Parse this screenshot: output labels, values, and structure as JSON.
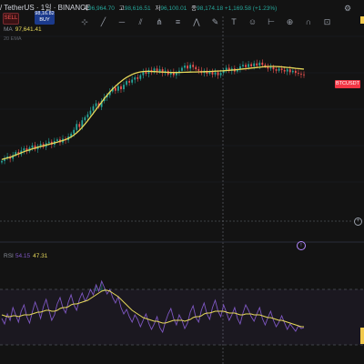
{
  "header": {
    "symbol_title": "/ TetherUS · 1일 · BINANCE",
    "ohlc": [
      {
        "label": "시",
        "value": "96,964.70"
      },
      {
        "label": "고",
        "value": "98,616.51"
      },
      {
        "label": "저",
        "value": "96,100.01"
      },
      {
        "label": "종",
        "value": "98,174.18"
      }
    ],
    "change": "+1,169.58 (+1.23%)"
  },
  "drawing_tools": [
    {
      "icon": "crosshair-icon",
      "glyph": "⊹"
    },
    {
      "icon": "trend-line-icon",
      "glyph": "╱"
    },
    {
      "icon": "horizontal-line-icon",
      "glyph": "─"
    },
    {
      "icon": "channel-icon",
      "glyph": "⫽"
    },
    {
      "icon": "pitchfork-icon",
      "glyph": "⋔"
    },
    {
      "icon": "fib-icon",
      "glyph": "≡"
    },
    {
      "icon": "pattern-icon",
      "glyph": "⋀"
    },
    {
      "icon": "brush-icon",
      "glyph": "✎"
    },
    {
      "icon": "text-icon",
      "glyph": "T"
    },
    {
      "icon": "emoji-icon",
      "glyph": "☺"
    },
    {
      "icon": "measure-icon",
      "glyph": "⊢"
    },
    {
      "icon": "zoom-icon",
      "glyph": "⊕"
    },
    {
      "icon": "magnet-icon",
      "glyph": "∩"
    },
    {
      "icon": "lock-icon",
      "glyph": "⊡"
    }
  ],
  "trade": {
    "sell_label": "SELL",
    "buy_price": "98,16.82",
    "buy_label": "BUY"
  },
  "indicators": {
    "ma_name": "MA",
    "ma_value": "97,641.41",
    "second_line": "20 EMA",
    "price_tag": "BTCUSDT",
    "rsi_name": "RSI",
    "rsi_value": "54.15",
    "rsi_ma_value": "47.31"
  },
  "colors": {
    "background": "#131313",
    "up": "#26a69a",
    "down": "#ef5350",
    "ma": "#e6d85a",
    "rsi": "#7e57c2"
  },
  "chart_data": [
    {
      "type": "line",
      "title": "",
      "xlabel": "",
      "ylabel": "",
      "x": [
        0,
        1,
        2,
        3,
        4,
        5,
        6,
        7,
        8,
        9,
        10,
        11,
        12,
        13,
        14,
        15,
        16,
        17,
        18,
        19,
        20,
        21,
        22,
        23,
        24,
        25,
        26,
        27,
        28,
        29,
        30,
        31,
        32,
        33,
        34,
        35,
        36,
        37,
        38,
        39,
        40,
        41,
        42,
        43,
        44,
        45,
        46,
        47,
        48,
        49,
        50,
        51,
        52,
        53,
        54,
        55,
        56,
        57,
        58,
        59,
        60,
        61,
        62,
        63,
        64,
        65,
        66,
        67,
        68,
        69,
        70,
        71,
        72,
        73,
        74,
        75,
        76,
        77,
        78,
        79,
        80,
        81,
        82,
        83,
        84,
        85,
        86,
        87,
        88,
        89,
        90,
        91,
        92,
        93,
        94,
        95,
        96,
        97,
        98,
        99,
        100,
        101,
        102,
        103,
        104,
        105,
        106,
        107,
        108,
        109
      ],
      "series": [
        {
          "values": [
            91500,
            91900,
            92100,
            91800,
            92300,
            92700,
            92400,
            92900,
            93200,
            92800,
            93300,
            93600,
            93100,
            93500,
            93800,
            93400,
            93900,
            94100,
            93700,
            94200,
            94400,
            94000,
            94500,
            94300,
            94800,
            95200,
            95700,
            96500,
            96100,
            97000,
            97400,
            97800,
            98300,
            98900,
            99300,
            98800,
            99600,
            100100,
            100400,
            100900,
            101400,
            101000,
            101600,
            101200,
            101800,
            102300,
            102100,
            102500,
            102800,
            102600,
            103100,
            103600,
            103300,
            103800,
            103500,
            104000,
            103600,
            103900,
            103400,
            103700,
            103200,
            103500,
            103100,
            103400,
            103700,
            104100,
            104400,
            104000,
            104500,
            104200,
            103900,
            103700,
            103400,
            103700,
            103300,
            103600,
            103200,
            103500,
            103100,
            103400,
            103800,
            104100,
            103700,
            104000,
            103600,
            103900,
            104300,
            104500,
            104200,
            104600,
            104300,
            104700,
            104400,
            104800,
            104500,
            104300,
            104000,
            104200,
            103900,
            103700,
            104000,
            103800,
            103600,
            103900,
            103500,
            103700,
            103400,
            103300,
            103200,
            103100
          ]
        },
        {
          "name": "MA",
          "values": [
            91700,
            91800,
            91900,
            92000,
            92150,
            92300,
            92450,
            92600,
            92750,
            92900,
            93000,
            93150,
            93250,
            93350,
            93450,
            93550,
            93650,
            93750,
            93850,
            93950,
            94050,
            94150,
            94250,
            94400,
            94550,
            94750,
            95000,
            95300,
            95650,
            96050,
            96500,
            96950,
            97450,
            97950,
            98450,
            98950,
            99450,
            99950,
            100400,
            100850,
            101250,
            101600,
            101950,
            102250,
            102550,
            102800,
            103000,
            103200,
            103350,
            103450,
            103550,
            103600,
            103620,
            103620,
            103600,
            103580,
            103560,
            103540,
            103520,
            103500,
            103480,
            103470,
            103460,
            103460,
            103470,
            103480,
            103500,
            103510,
            103520,
            103530,
            103540,
            103550,
            103560,
            103570,
            103580,
            103600,
            103620,
            103640,
            103660,
            103680,
            103700,
            103730,
            103760,
            103790,
            103820,
            103860,
            103900,
            103940,
            103980,
            104020,
            104060,
            104100,
            104140,
            104180,
            104220,
            104250,
            104270,
            104280,
            104280,
            104270,
            104250,
            104220,
            104190,
            104150,
            104110,
            104070,
            104030,
            103990,
            103950,
            103910
          ]
        }
      ]
    },
    {
      "type": "line",
      "title": "",
      "xlabel": "",
      "ylabel": "",
      "x": [
        0,
        1,
        2,
        3,
        4,
        5,
        6,
        7,
        8,
        9,
        10,
        11,
        12,
        13,
        14,
        15,
        16,
        17,
        18,
        19,
        20,
        21,
        22,
        23,
        24,
        25,
        26,
        27,
        28,
        29,
        30,
        31,
        32,
        33,
        34,
        35,
        36,
        37,
        38,
        39,
        40,
        41,
        42,
        43,
        44,
        45,
        46,
        47,
        48,
        49,
        50,
        51,
        52,
        53,
        54,
        55,
        56,
        57,
        58,
        59,
        60,
        61,
        62,
        63,
        64,
        65,
        66,
        67,
        68,
        69,
        70,
        71,
        72,
        73,
        74,
        75,
        76,
        77,
        78,
        79,
        80,
        81,
        82,
        83,
        84,
        85,
        86,
        87,
        88,
        89,
        90,
        91,
        92,
        93,
        94,
        95,
        96,
        97,
        98,
        99,
        100,
        101,
        102,
        103,
        104,
        105,
        106,
        107,
        108,
        109
      ],
      "ylim": [
        0,
        100
      ],
      "series": [
        {
          "name": "RSI",
          "values": [
            40,
            34,
            45,
            38,
            52,
            44,
            36,
            48,
            55,
            42,
            35,
            47,
            58,
            50,
            40,
            53,
            61,
            49,
            38,
            44,
            56,
            63,
            52,
            46,
            58,
            66,
            55,
            49,
            61,
            68,
            59,
            64,
            72,
            66,
            77,
            70,
            81,
            74,
            67,
            72,
            63,
            57,
            64,
            52,
            45,
            50,
            42,
            36,
            44,
            39,
            31,
            38,
            45,
            35,
            28,
            34,
            42,
            30,
            25,
            36,
            45,
            51,
            40,
            33,
            44,
            38,
            29,
            35,
            47,
            54,
            41,
            36,
            49,
            57,
            45,
            39,
            52,
            60,
            48,
            42,
            55,
            47,
            38,
            44,
            52,
            40,
            34,
            46,
            55,
            49,
            42,
            37,
            45,
            52,
            40,
            33,
            41,
            48,
            38,
            31,
            36,
            43,
            35,
            28,
            34,
            30,
            26,
            32,
            29,
            30
          ]
        },
        {
          "name": "RSI MA",
          "values": [
            44,
            43,
            42,
            42,
            43,
            43,
            42,
            43,
            44,
            44,
            44,
            45,
            46,
            47,
            47,
            48,
            49,
            49,
            48,
            48,
            49,
            51,
            52,
            52,
            53,
            55,
            56,
            56,
            57,
            58,
            59,
            60,
            62,
            64,
            66,
            68,
            70,
            71,
            71,
            70,
            68,
            66,
            64,
            61,
            58,
            55,
            52,
            49,
            47,
            45,
            43,
            41,
            40,
            39,
            38,
            37,
            37,
            36,
            35,
            35,
            36,
            37,
            38,
            38,
            38,
            38,
            37,
            38,
            39,
            41,
            42,
            42,
            43,
            45,
            46,
            46,
            47,
            48,
            48,
            48,
            48,
            47,
            46,
            46,
            46,
            45,
            44,
            44,
            45,
            45,
            45,
            44,
            44,
            44,
            43,
            42,
            41,
            41,
            40,
            39,
            38,
            38,
            37,
            36,
            35,
            34,
            33,
            32,
            31,
            31
          ]
        }
      ]
    }
  ]
}
